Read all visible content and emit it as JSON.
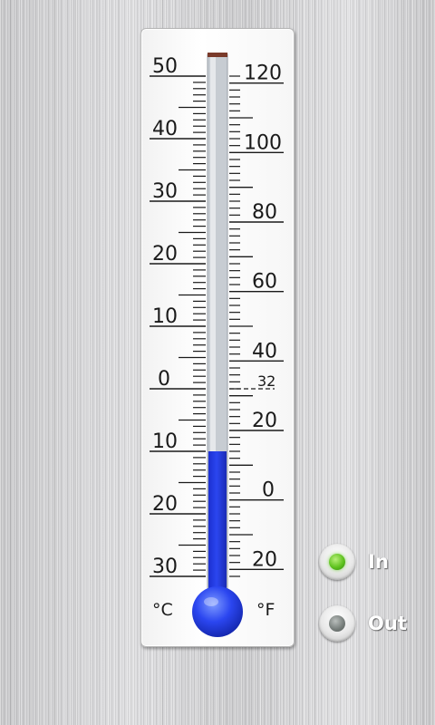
{
  "thermometer": {
    "celsius_unit": "°C",
    "fahrenheit_unit": "°F",
    "celsius_labels": [
      "50",
      "40",
      "30",
      "20",
      "10",
      "0",
      "10",
      "20",
      "30"
    ],
    "fahrenheit_labels": [
      "120",
      "100",
      "80",
      "60",
      "40",
      "32",
      "20",
      "0",
      "20"
    ],
    "reading_celsius": -10,
    "mercury_color": "#2b46f0",
    "scale_color": "#1a1a1a"
  },
  "source_toggle": {
    "in_label": "In",
    "out_label": "Out",
    "selected": "In",
    "active_color": "#5fc21f"
  }
}
